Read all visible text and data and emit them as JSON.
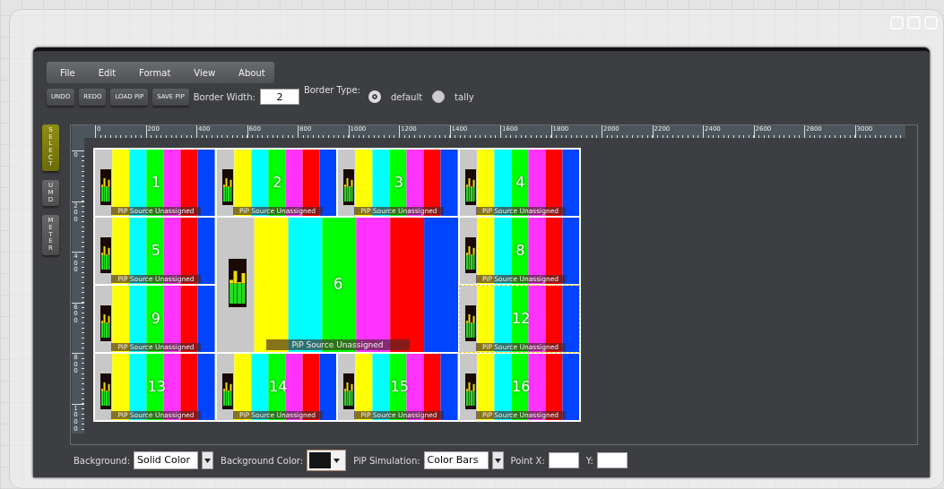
{
  "menu": [
    "File",
    "Edit",
    "Format",
    "View",
    "About"
  ],
  "toolbar": {
    "buttons": [
      "UNDO",
      "REDO",
      "LOAD PiP",
      "SAVE PiP"
    ],
    "border_width": {
      "label": "Border Width:",
      "value": "2"
    },
    "border_type": {
      "label": "Border Type:",
      "options": [
        {
          "label": "default",
          "selected": true
        },
        {
          "label": "tally",
          "selected": false
        }
      ]
    }
  },
  "side_tabs": [
    {
      "label": "SELECT",
      "selected": true
    },
    {
      "label": "UMD",
      "selected": false
    },
    {
      "label": "METER",
      "selected": false
    }
  ],
  "ruler": {
    "x_labels": [
      "0",
      "200",
      "400",
      "600",
      "800",
      "1000",
      "1200",
      "1400",
      "1600",
      "1800",
      "2000",
      "2200",
      "2400",
      "2600",
      "2800",
      "3000"
    ],
    "y_labels": [
      "0",
      "200",
      "400",
      "600",
      "800",
      "1000"
    ]
  },
  "tiles": [
    {
      "number": "1",
      "caption": "PiP Source Unassigned",
      "kind": "small",
      "selected": false
    },
    {
      "number": "2",
      "caption": "PiP Source Unassigned",
      "kind": "small",
      "selected": false
    },
    {
      "number": "3",
      "caption": "PiP Source Unassigned",
      "kind": "small",
      "selected": false
    },
    {
      "number": "4",
      "caption": "PiP Source Unassigned",
      "kind": "small",
      "selected": false
    },
    {
      "number": "5",
      "caption": "PiP Source Unassigned",
      "kind": "small",
      "selected": false
    },
    {
      "number": "6",
      "caption": "PiP Source Unassigned",
      "kind": "large",
      "selected": false
    },
    {
      "number": "8",
      "caption": "PiP Source Unassigned",
      "kind": "small",
      "selected": false
    },
    {
      "number": "9",
      "caption": "PiP Source Unassigned",
      "kind": "small",
      "selected": false
    },
    {
      "number": "12",
      "caption": "PiP Source Unassigned",
      "kind": "small",
      "selected": true
    },
    {
      "number": "13",
      "caption": "PiP Source Unassigned",
      "kind": "small",
      "selected": false
    },
    {
      "number": "14",
      "caption": "PiP Source Unassigned",
      "kind": "small",
      "selected": false
    },
    {
      "number": "15",
      "caption": "PiP Source Unassigned",
      "kind": "small",
      "selected": false
    },
    {
      "number": "16",
      "caption": "PiP Source Unassigned",
      "kind": "small",
      "selected": false
    }
  ],
  "bottom": {
    "background": {
      "label": "Background:",
      "value": "Solid Color"
    },
    "background_color": {
      "label": "Background Color:",
      "color": "#151515"
    },
    "pip_simulation": {
      "label": "PiP Simulation:",
      "value": "Color Bars"
    },
    "point_x": {
      "label": "Point X:"
    },
    "point_y": {
      "label": "Y:"
    }
  }
}
